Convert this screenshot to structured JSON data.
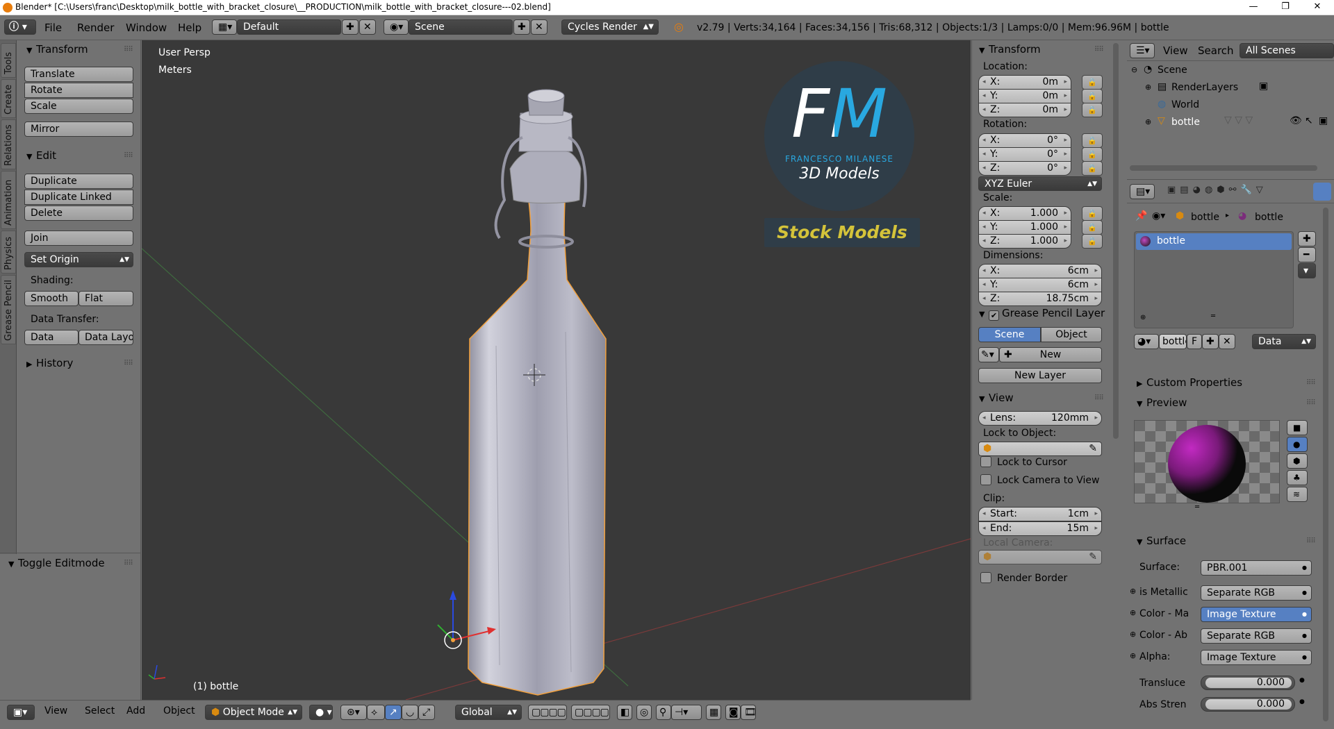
{
  "window": {
    "title": "Blender* [C:\\Users\\franc\\Desktop\\milk_bottle_with_bracket_closure\\__PRODUCTION\\milk_bottle_with_bracket_closure---02.blend]",
    "minimize": "—",
    "maximize": "❐",
    "close": "✕"
  },
  "menu": {
    "items": [
      "File",
      "Render",
      "Window",
      "Help"
    ],
    "layout": "Default",
    "scene": "Scene",
    "engine": "Cycles Render",
    "stats": "v2.79 | Verts:34,164 | Faces:34,156 | Tris:68,312 | Objects:1/3 | Lamps:0/0 | Mem:96.96M | bottle"
  },
  "lefttabs": [
    "Tools",
    "Create",
    "Relations",
    "Animation",
    "Physics",
    "Grease Pencil"
  ],
  "toolshelf": {
    "transform_header": "Transform",
    "translate": "Translate",
    "rotate": "Rotate",
    "scale": "Scale",
    "mirror": "Mirror",
    "edit_header": "Edit",
    "duplicate": "Duplicate",
    "duplicate_linked": "Duplicate Linked",
    "delete": "Delete",
    "join": "Join",
    "set_origin": "Set Origin",
    "shading_label": "Shading:",
    "smooth": "Smooth",
    "flat": "Flat",
    "data_transfer_label": "Data Transfer:",
    "data": "Data",
    "data_layo": "Data Layo",
    "history_header": "History",
    "toggle_editmode": "Toggle Editmode"
  },
  "viewport": {
    "view_name": "User Persp",
    "units": "Meters",
    "object_label": "(1) bottle",
    "logo_initials": "FM",
    "logo_name": "FRANCESCO MILANESE",
    "logo_sub": "3D Models",
    "logo_banner": "Stock Models"
  },
  "npanel": {
    "transform_header": "Transform",
    "location_label": "Location:",
    "loc": [
      {
        "l": "X:",
        "v": "0m"
      },
      {
        "l": "Y:",
        "v": "0m"
      },
      {
        "l": "Z:",
        "v": "0m"
      }
    ],
    "rotation_label": "Rotation:",
    "rot": [
      {
        "l": "X:",
        "v": "0°"
      },
      {
        "l": "Y:",
        "v": "0°"
      },
      {
        "l": "Z:",
        "v": "0°"
      }
    ],
    "rotation_mode": "XYZ Euler",
    "scale_label": "Scale:",
    "scl": [
      {
        "l": "X:",
        "v": "1.000"
      },
      {
        "l": "Y:",
        "v": "1.000"
      },
      {
        "l": "Z:",
        "v": "1.000"
      }
    ],
    "dimensions_label": "Dimensions:",
    "dim": [
      {
        "l": "X:",
        "v": "6cm"
      },
      {
        "l": "Y:",
        "v": "6cm"
      },
      {
        "l": "Z:",
        "v": "18.75cm"
      }
    ],
    "gp_header": "Grease Pencil Layer",
    "gp_scene": "Scene",
    "gp_object": "Object",
    "gp_new": "New",
    "gp_new_layer": "New Layer",
    "view_header": "View",
    "lens_label": "Lens:",
    "lens_value": "120mm",
    "lock_to_object_label": "Lock to Object:",
    "lock_to_cursor": "Lock to Cursor",
    "lock_camera_to_view": "Lock Camera to View",
    "clip_label": "Clip:",
    "clip_start_label": "Start:",
    "clip_start": "1cm",
    "clip_end_label": "End:",
    "clip_end": "15m",
    "local_camera_label": "Local Camera:",
    "render_border": "Render Border"
  },
  "outliner": {
    "view": "View",
    "search": "Search",
    "all_scenes": "All Scenes",
    "scene": "Scene",
    "renderlayers": "RenderLayers",
    "world": "World",
    "bottle": "bottle"
  },
  "properties": {
    "crumb_object": "bottle",
    "crumb_material": "bottle",
    "material_slot": "bottle",
    "mat_name": "bottle",
    "mat_fake": "F",
    "mat_link": "Data",
    "custom_properties": "Custom Properties",
    "preview": "Preview",
    "surface_header": "Surface",
    "surface_label": "Surface:",
    "surface_value": "PBR.001",
    "rows": [
      {
        "l": "is Metallic",
        "v": "Separate RGB"
      },
      {
        "l": "Color - Ma",
        "v": "Image Texture"
      },
      {
        "l": "Color - Ab",
        "v": "Separate RGB"
      },
      {
        "l": "Alpha:",
        "v": "Image Texture"
      }
    ],
    "transluce_label": "Transluce",
    "transluce_value": "0.000",
    "abs_label": "Abs Stren",
    "abs_value": "0.000"
  },
  "bottombar": {
    "view": "View",
    "select": "Select",
    "add": "Add",
    "object": "Object",
    "mode": "Object Mode",
    "orientation": "Global"
  },
  "colors": {
    "accent": "#5680c2",
    "selection_orange": "#f2a03c",
    "logo_blue": "#29a8e0",
    "logo_yellow": "#d4c33a"
  }
}
